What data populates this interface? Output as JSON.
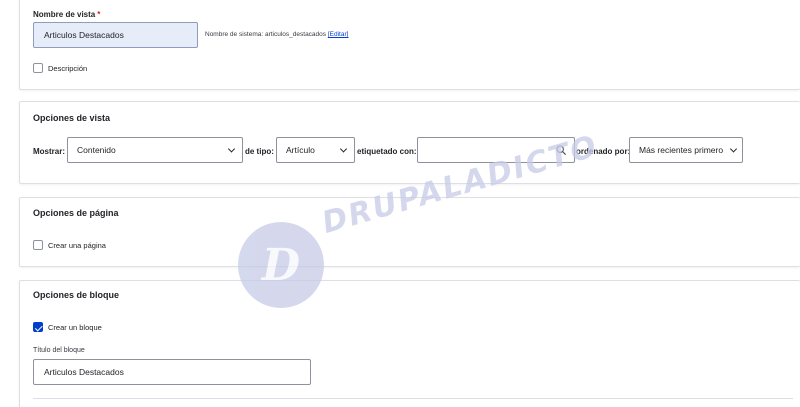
{
  "view_name": {
    "label": "Nombre de vista",
    "required_mark": "*",
    "value": "Articulos Destacados",
    "system_name_prefix": "Nombre de sistema: articulos_destacados",
    "edit_link": "[Editar]",
    "description_label": "Descripción"
  },
  "view_options": {
    "title": "Opciones de vista",
    "show_label": "Mostrar:",
    "show_value": "Contenido",
    "type_label": "de tipo:",
    "type_value": "Artículo",
    "tagged_label": "etiquetado con:",
    "tagged_value": "",
    "sort_label": "ordenado por:",
    "sort_value": "Más recientes primero"
  },
  "page_options": {
    "title": "Opciones de página",
    "create_page_label": "Crear una página",
    "create_page_checked": false
  },
  "block_options": {
    "title": "Opciones de bloque",
    "create_block_label": "Crear un bloque",
    "create_block_checked": true,
    "block_title_label": "Título del bloque",
    "block_title_value": "Articulos Destacados"
  },
  "watermark": {
    "letter": "D",
    "text": "DRUPALADICTO"
  },
  "colors": {
    "accent": "#003ecc",
    "required": "#d72222",
    "border": "#8e929c",
    "input_focus_bg": "#e6ecf8",
    "watermark": "#c7cce8"
  }
}
